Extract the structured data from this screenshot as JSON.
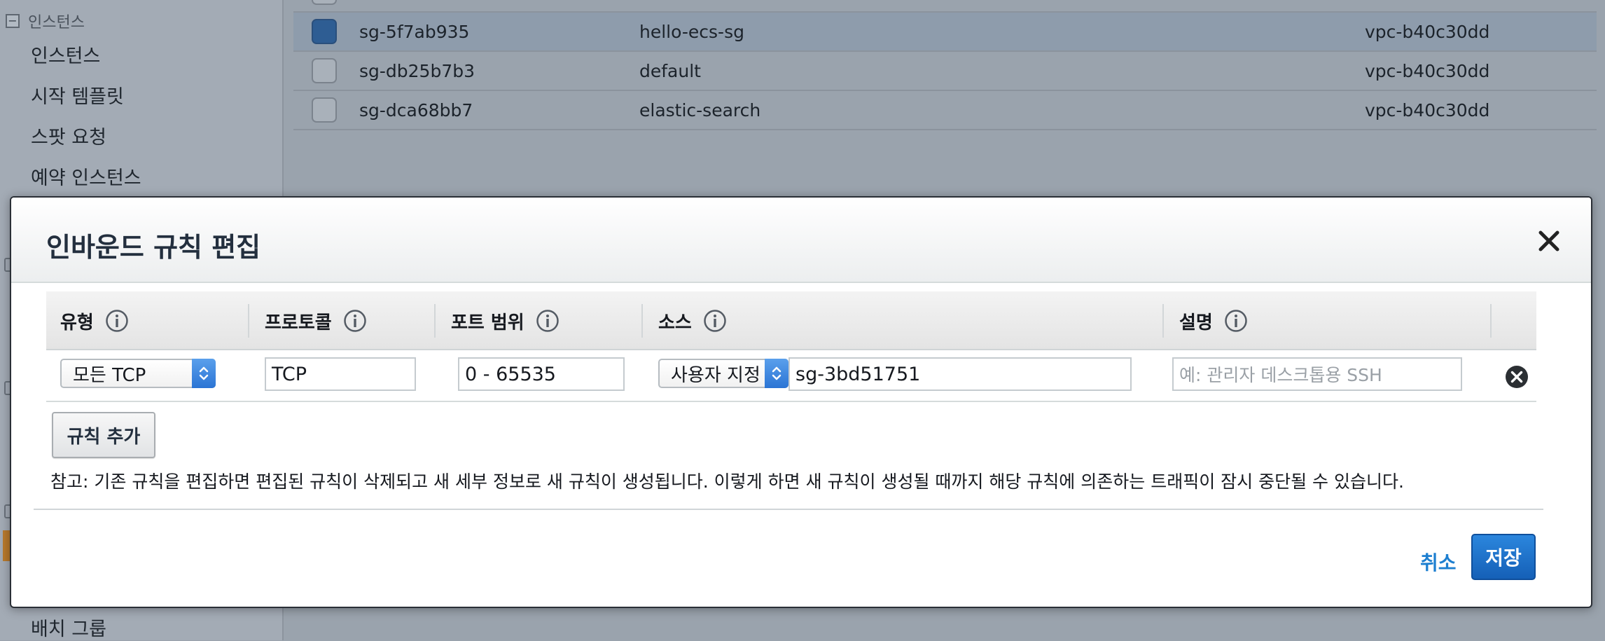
{
  "sidebar": {
    "section_label": "인스턴스",
    "section_toggle": "−",
    "items": [
      {
        "label": "인스턴스"
      },
      {
        "label": "시작 템플릿"
      },
      {
        "label": "스팟 요청"
      },
      {
        "label": "예약 인스턴스"
      }
    ],
    "bottom_item": {
      "label": "배치 그룹"
    }
  },
  "security_groups": {
    "rows": [
      {
        "id": "sg-5f7ab935",
        "name": "hello-ecs-sg",
        "vpc": "vpc-b40c30dd",
        "selected": true
      },
      {
        "id": "sg-db25b7b3",
        "name": "default",
        "vpc": "vpc-b40c30dd",
        "selected": false
      },
      {
        "id": "sg-dca68bb7",
        "name": "elastic-search",
        "vpc": "vpc-b40c30dd",
        "selected": false
      }
    ]
  },
  "modal": {
    "title": "인바운드 규칙 편집",
    "columns": {
      "type": "유형",
      "protocol": "프로토콜",
      "port_range": "포트 범위",
      "source": "소스",
      "description": "설명"
    },
    "rule": {
      "type_value": "모든 TCP",
      "protocol_value": "TCP",
      "port_range_value": "0 - 65535",
      "source_type_value": "사용자 지정",
      "source_value": "sg-3bd51751",
      "description_placeholder": "예: 관리자 데스크톱용 SSH"
    },
    "add_rule_label": "규칙 추가",
    "note": "참고: 기존 규칙을 편집하면 편집된 규칙이 삭제되고 새 세부 정보로 새 규칙이 생성됩니다. 이렇게 하면 새 규칙이 생성될 때까지 해당 규칙에 의존하는 트래픽이 잠시 중단될 수 있습니다.",
    "cancel_label": "취소",
    "save_label": "저장"
  },
  "colors": {
    "primary": "#1560b7",
    "link": "#1d7fd0",
    "overlay": "#9aa3ad"
  },
  "icons": {
    "close": "close-icon",
    "info": "info-icon",
    "remove": "remove-circle-icon",
    "select": "chevron-up-down-icon"
  }
}
